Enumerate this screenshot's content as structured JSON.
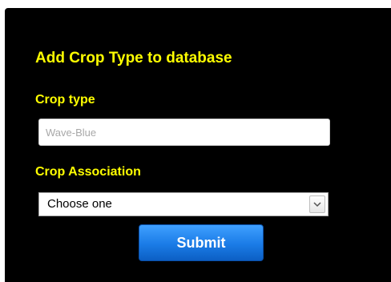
{
  "form": {
    "title": "Add Crop Type to database",
    "crop_type_label": "Crop type",
    "crop_type_placeholder": "Wave-Blue",
    "crop_association_label": "Crop Association",
    "crop_association_selected": "Choose one",
    "submit_label": "Submit"
  },
  "colors": {
    "panel_background": "#000000",
    "label_color": "#ffff00",
    "button_color": "#1a7be6"
  },
  "icons": {
    "select_arrow": "chevron-down-icon"
  }
}
